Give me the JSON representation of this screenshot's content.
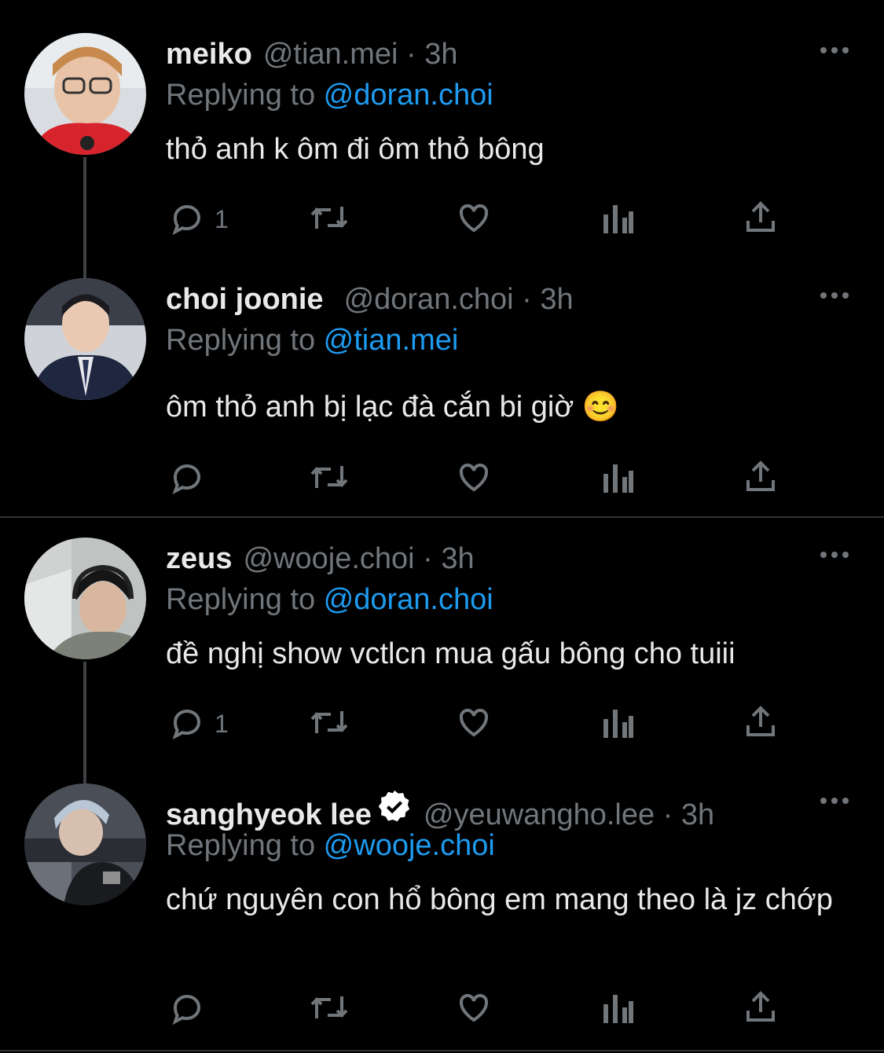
{
  "tweets": [
    {
      "name": "meiko",
      "handle": "@tian.mei · 3h",
      "replying_prefix": "Replying to ",
      "replying_to": "@doran.choi",
      "text": "thỏ anh k ôm đi ôm thỏ bông",
      "reply_count": "1",
      "verified": false
    },
    {
      "name": "choi joonie",
      "handle": "@doran.choi · 3h",
      "replying_prefix": "Replying to ",
      "replying_to": "@tian.mei",
      "text": "ôm thỏ anh bị lạc đà cắn bi giờ 😊",
      "reply_count": "",
      "verified": false
    },
    {
      "name": "zeus",
      "handle": "@wooje.choi · 3h",
      "replying_prefix": "Replying to ",
      "replying_to": "@doran.choi",
      "text": "đề nghị show vctlcn mua gấu bông cho tuiii",
      "reply_count": "1",
      "verified": false
    },
    {
      "name": "sanghyeok lee",
      "handle": "@yeuwangho.lee · 3h",
      "replying_prefix": "Replying to ",
      "replying_to": "@wooje.choi",
      "text": "chứ nguyên con hổ bông em mang theo là jz chớp",
      "reply_count": "",
      "verified": true
    }
  ],
  "icons": [
    "reply-icon",
    "retweet-icon",
    "like-icon",
    "analytics-icon",
    "share-icon",
    "more-icon",
    "verified-badge-icon"
  ],
  "colors": {
    "background": "#000000",
    "text": "#e7e9ea",
    "muted": "#71767b",
    "link": "#1d9bf0",
    "divider": "#2f3336"
  }
}
